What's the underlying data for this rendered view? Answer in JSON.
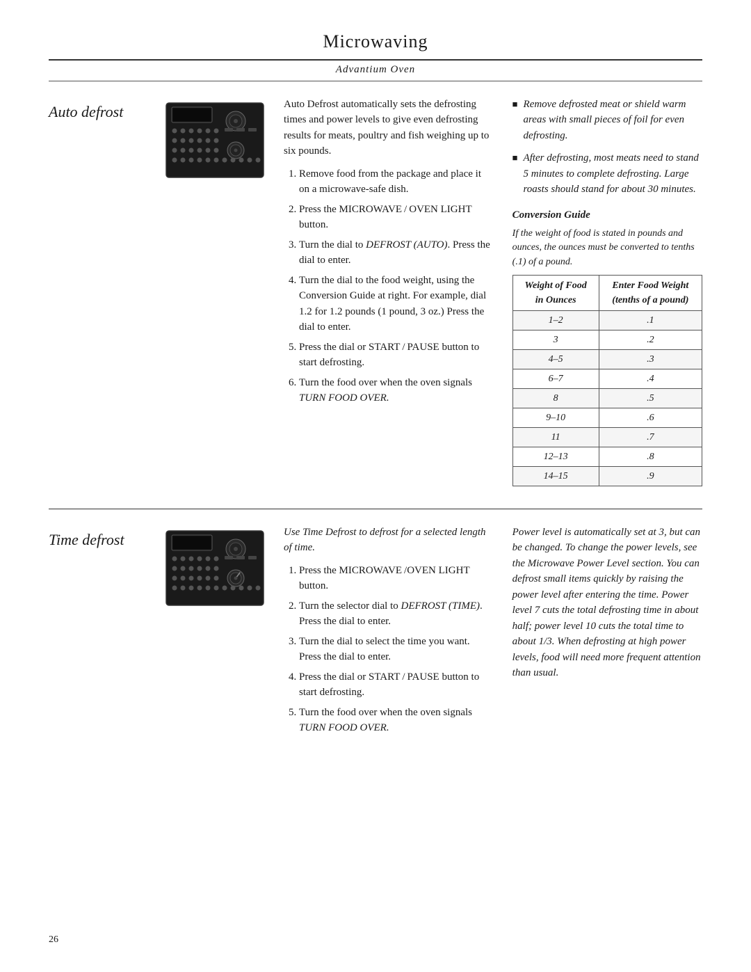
{
  "header": {
    "title": "Microwaving",
    "subtitle": "Advantium Oven"
  },
  "auto_defrost": {
    "label": "Auto defrost",
    "intro": "Auto Defrost automatically sets the defrosting times and power levels to give even defrosting results for meats, poultry and fish weighing up to six pounds.",
    "steps": [
      "Remove food from the package and place it on a microwave-safe dish.",
      "Press the MICROWAVE / OVEN LIGHT button.",
      "Turn the dial to DEFROST (AUTO). Press the dial to enter.",
      "Turn the dial to the food weight, using the Conversion Guide at right. For example, dial 1.2 for 1.2 pounds (1 pound, 3 oz.) Press the dial to enter.",
      "Press the dial or START / PAUSE button to start defrosting.",
      "Turn the food over when the oven signals TURN FOOD OVER."
    ],
    "step3_defrost": "DEFROST",
    "step3_auto": "(AUTO)",
    "step4_turnfood": "TURN FOOD OVER",
    "bullets": [
      "Remove defrosted meat or shield warm areas with small pieces of foil for even defrosting.",
      "After defrosting, most meats need to stand 5 minutes to complete defrosting. Large roasts should stand for about 30 minutes."
    ],
    "conversion_guide": {
      "title": "Conversion Guide",
      "note": "If the weight of food is stated in pounds and ounces, the ounces must be converted to tenths (.1) of a pound.",
      "col1_header": "Weight of Food in Ounces",
      "col2_header": "Enter Food Weight (tenths of a pound)",
      "rows": [
        {
          "oz": "1–2",
          "tenths": ".1"
        },
        {
          "oz": "3",
          "tenths": ".2"
        },
        {
          "oz": "4–5",
          "tenths": ".3"
        },
        {
          "oz": "6–7",
          "tenths": ".4"
        },
        {
          "oz": "8",
          "tenths": ".5"
        },
        {
          "oz": "9–10",
          "tenths": ".6"
        },
        {
          "oz": "11",
          "tenths": ".7"
        },
        {
          "oz": "12–13",
          "tenths": ".8"
        },
        {
          "oz": "14–15",
          "tenths": ".9"
        }
      ]
    }
  },
  "time_defrost": {
    "label": "Time defrost",
    "intro": "Use Time Defrost to defrost for a selected length of time.",
    "steps": [
      "Press the MICROWAVE /OVEN LIGHT button.",
      "Turn the selector dial to DEFROST (TIME). Press the dial to enter.",
      "Turn the dial to select the time you want. Press the dial to enter.",
      "Press the dial or START / PAUSE button to start defrosting.",
      "Turn the food over when the oven signals TURN FOOD OVER."
    ],
    "step2_defrost": "DEFROST (TIME)",
    "step5_turnfood": "TURN FOOD OVER",
    "right_text": "Power level is automatically set at 3, but can be changed. To change the power levels, see the Microwave Power Level section. You can defrost small items quickly by raising the power level after entering the time. Power level 7 cuts the total defrosting time in about half; power level 10 cuts the total time to about 1/3. When defrosting at high power levels, food will need more frequent attention than usual."
  },
  "page_number": "26"
}
